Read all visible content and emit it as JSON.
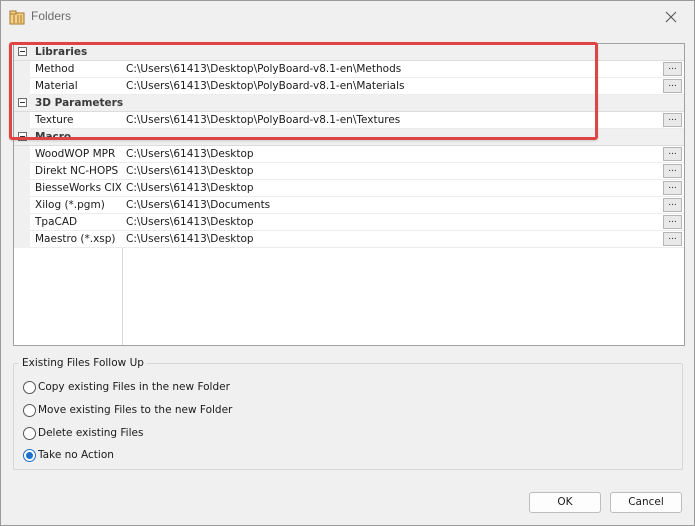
{
  "window": {
    "title": "Folders"
  },
  "grid": {
    "categories": [
      {
        "label": "Libraries",
        "items": [
          {
            "name": "Method",
            "value": "C:\\Users\\61413\\Desktop\\PolyBoard-v8.1-en\\Methods"
          },
          {
            "name": "Material",
            "value": "C:\\Users\\61413\\Desktop\\PolyBoard-v8.1-en\\Materials"
          }
        ]
      },
      {
        "label": "3D Parameters",
        "items": [
          {
            "name": "Texture",
            "value": "C:\\Users\\61413\\Desktop\\PolyBoard-v8.1-en\\Textures"
          }
        ]
      },
      {
        "label": "Macro",
        "items": [
          {
            "name": "WoodWOP MPR",
            "value": "C:\\Users\\61413\\Desktop"
          },
          {
            "name": "Direkt NC-HOPS",
            "value": "C:\\Users\\61413\\Desktop"
          },
          {
            "name": "BiesseWorks CIX",
            "value": "C:\\Users\\61413\\Desktop"
          },
          {
            "name": "Xilog (*.pgm)",
            "value": "C:\\Users\\61413\\Documents"
          },
          {
            "name": "TpaCAD",
            "value": "C:\\Users\\61413\\Desktop"
          },
          {
            "name": "Maestro (*.xsp)",
            "value": "C:\\Users\\61413\\Desktop"
          }
        ]
      }
    ],
    "browse_label": "..."
  },
  "followup": {
    "title": "Existing Files Follow Up",
    "options": [
      {
        "label": "Copy existing Files in the new Folder",
        "checked": false
      },
      {
        "label": "Move existing Files to the new Folder",
        "checked": false
      },
      {
        "label": "Delete existing Files",
        "checked": false
      },
      {
        "label": "Take no Action",
        "checked": true
      }
    ]
  },
  "buttons": {
    "ok": "OK",
    "cancel": "Cancel"
  },
  "colors": {
    "highlight": "#e04343",
    "accent": "#1f6fce"
  }
}
